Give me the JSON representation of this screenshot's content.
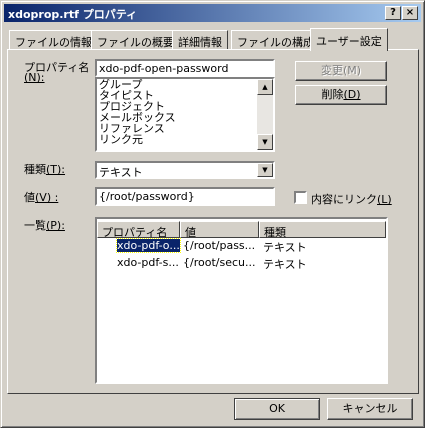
{
  "window": {
    "title": "xdoprop.rtf プロパティ",
    "help_btn": "?",
    "close_btn": "×"
  },
  "tabs": [
    {
      "label": "ファイルの情報"
    },
    {
      "label": "ファイルの概要"
    },
    {
      "label": "詳細情報"
    },
    {
      "label": "ファイルの構成"
    },
    {
      "label": "ユーザー設定",
      "active": true
    }
  ],
  "property_name": {
    "label": "プロパティ名",
    "accel": "(N):",
    "value": "xdo-pdf-open-password"
  },
  "name_list": [
    "グループ",
    "タイピスト",
    "プロジェクト",
    "メールボックス",
    "リファレンス",
    "リンク元"
  ],
  "change_button": {
    "label": "変更",
    "accel": "(M)"
  },
  "delete_button": {
    "label": "削除",
    "accel": "(D)"
  },
  "type": {
    "label": "種類",
    "accel": "(T):",
    "value": "テキスト"
  },
  "value": {
    "label": "値",
    "accel": "(V) :",
    "value": "{/root/password}"
  },
  "link_to_content": {
    "label": "内容にリンク",
    "accel": "(L)",
    "checked": false
  },
  "list": {
    "label": "一覧",
    "accel": "(P):",
    "columns": [
      "プロパティ名",
      "値",
      "種類"
    ],
    "rows": [
      [
        "xdo-pdf-o...",
        "{/root/pass...",
        "テキスト"
      ],
      [
        "xdo-pdf-s...",
        "{/root/secu...",
        "テキスト"
      ]
    ]
  },
  "ok_button": "OK",
  "cancel_button": "キャンセル"
}
